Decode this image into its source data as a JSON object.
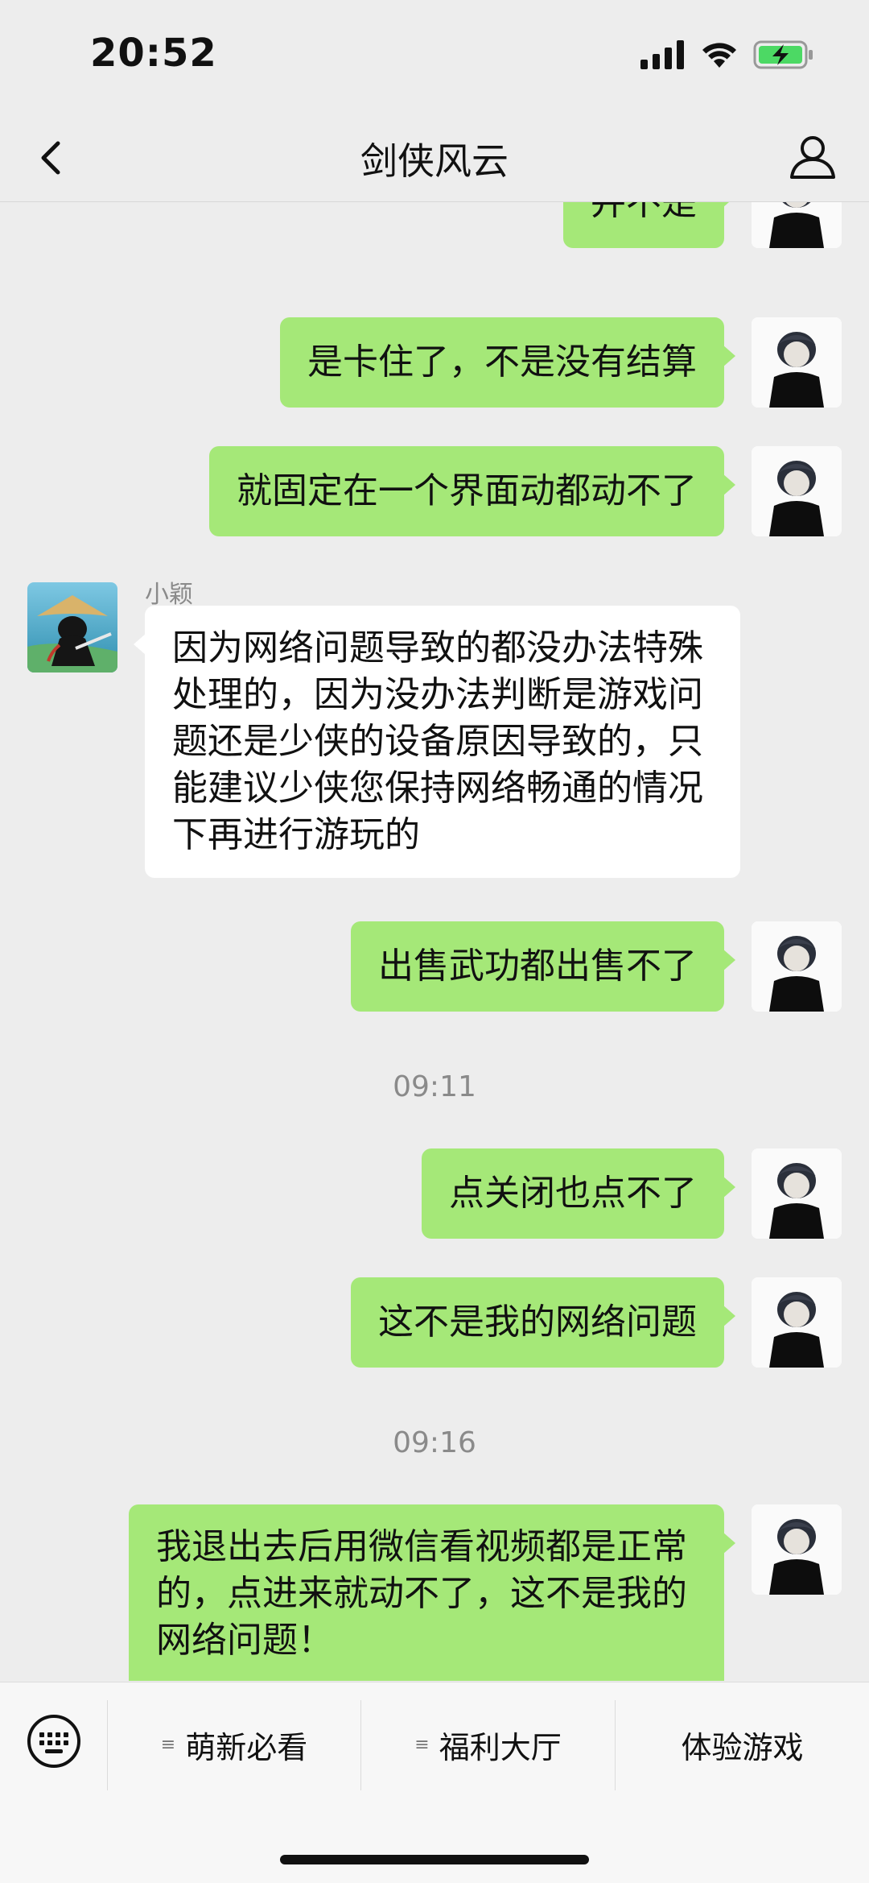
{
  "status_bar": {
    "time": "20:52"
  },
  "nav": {
    "title": "剑侠风云"
  },
  "messages": [
    {
      "type": "sent",
      "text": "并不是"
    },
    {
      "type": "sent",
      "text": "是卡住了，不是没有结算"
    },
    {
      "type": "sent",
      "text": "就固定在一个界面动都动不了"
    },
    {
      "type": "received",
      "sender": "小颖",
      "text": "因为网络问题导致的都没办法特殊处理的，因为没办法判断是游戏问题还是少侠的设备原因导致的，只能建议少侠您保持网络畅通的情况下再进行游玩的"
    },
    {
      "type": "sent",
      "text": "出售武功都出售不了"
    },
    {
      "type": "time",
      "text": "09:11"
    },
    {
      "type": "sent",
      "text": "点关闭也点不了"
    },
    {
      "type": "sent",
      "text": "这不是我的网络问题"
    },
    {
      "type": "time",
      "text": "09:16"
    },
    {
      "type": "sent",
      "text": "我退出去后用微信看视频都是正常的，点进来就动不了，这不是我的网络问题！"
    }
  ],
  "bottom_menu": {
    "items": [
      {
        "label": "萌新必看"
      },
      {
        "label": "福利大厅"
      },
      {
        "label": "体验游戏"
      }
    ],
    "submenu_icon": "≡"
  },
  "icons": {
    "back": "chevron-left-icon",
    "profile": "person-icon",
    "keyboard": "keyboard-icon",
    "signal": "cellular-signal-icon",
    "wifi": "wifi-icon",
    "battery": "battery-charging-icon"
  },
  "colors": {
    "sent_bubble": "#a5e878",
    "received_bubble": "#ffffff",
    "background": "#ededed",
    "battery_fill": "#4cd964"
  }
}
